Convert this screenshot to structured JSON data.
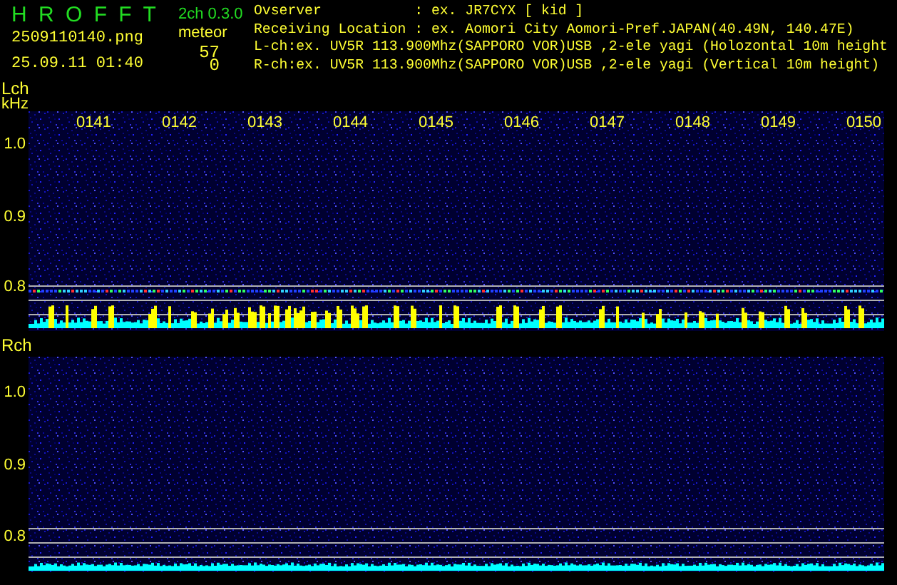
{
  "header": {
    "title": "H R O F F T",
    "version": "2ch 0.3.0",
    "filename": "2509110140.png",
    "datetime": "25.09.11 01:40",
    "meteor_label": "meteor",
    "meteor_counts": [
      "57",
      "0"
    ],
    "info_lines": [
      "Ovserver           : ex. JR7CYX [ kid ]",
      "Receiving Location : ex. Aomori City Aomori-Pref.JAPAN(40.49N, 140.47E)",
      "L-ch:ex. UV5R 113.900Mhz(SAPPORO VOR)USB ,2-ele yagi (Holozontal 10m height",
      "R-ch:ex. UV5R 113.900Mhz(SAPPORO VOR)USB ,2-ele yagi (Vertical 10m height)"
    ]
  },
  "channels": [
    {
      "label": "Lch",
      "unit": "kHz",
      "time_labels": [
        "0141",
        "0142",
        "0143",
        "0144",
        "0145",
        "0146",
        "0147",
        "0148",
        "0149",
        "0150"
      ],
      "y_labels": [
        "1.0",
        "0.9",
        "0.8"
      ]
    },
    {
      "label": "Rch",
      "y_labels": [
        "1.0",
        "0.9",
        "0.8"
      ]
    }
  ]
}
